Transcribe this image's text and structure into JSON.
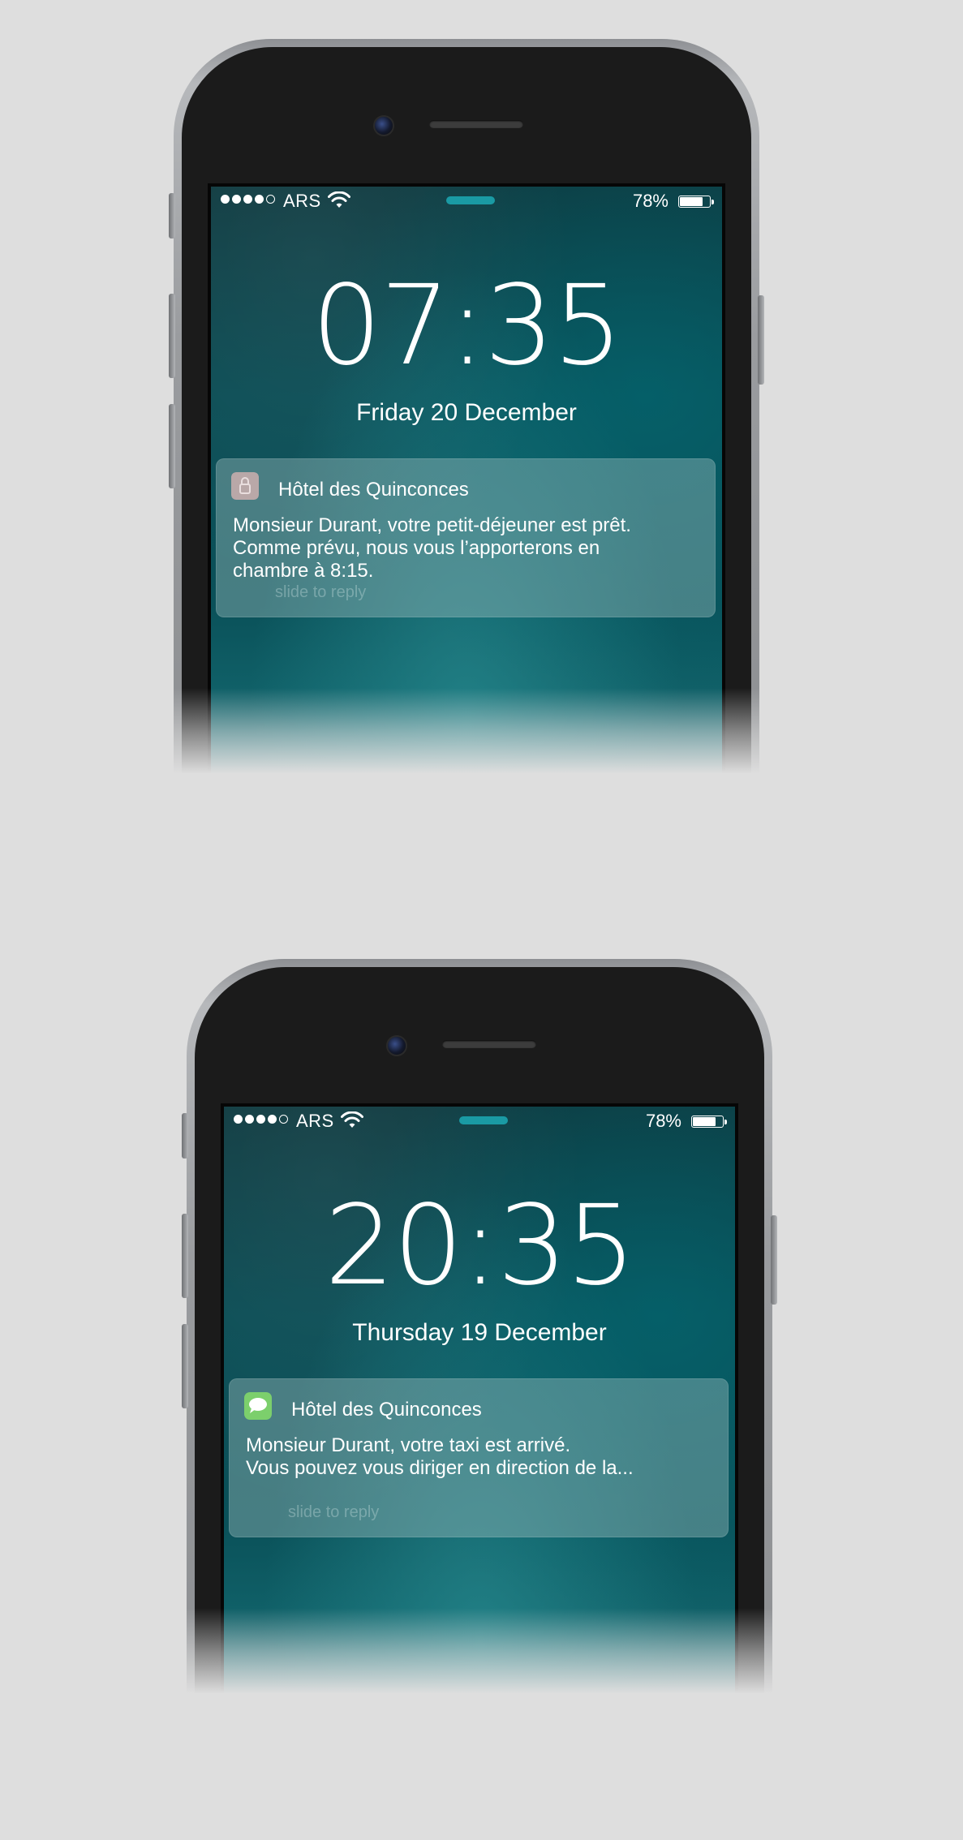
{
  "phones": [
    {
      "status": {
        "carrier": "ARS",
        "battery": "78%",
        "battery_level": 0.78,
        "signal_bars": 4,
        "signal_max": 5
      },
      "clock": "07:35",
      "date": "Friday 20 December",
      "notification": {
        "app_icon": "lock-icon",
        "app_name": "Hôtel des Quinconces",
        "body": "Monsieur Durant, votre petit-déjeuner est prêt.\nComme prévu, nous vous l’apporterons en chambre à 8:15.",
        "line1": "Monsieur Durant, votre petit-déjeuner est prêt.",
        "line2": "Comme prévu, nous vous l’apporterons en",
        "line3": "chambre à 8:15.",
        "hint": "slide to reply"
      }
    },
    {
      "status": {
        "carrier": "ARS",
        "battery": "78%",
        "battery_level": 0.78,
        "signal_bars": 4,
        "signal_max": 5
      },
      "clock": "20:35",
      "date": "Thursday 19 December",
      "notification": {
        "app_icon": "messages-icon",
        "app_name": "Hôtel des Quinconces",
        "line1": "Monsieur Durant, votre taxi est arrivé.",
        "line2": "Vous pouvez vous diriger en direction de la...",
        "hint": "slide to reply"
      }
    }
  ],
  "colors": {
    "background": "#dedede",
    "lock_handle": "#1a9aa4",
    "messages_green": "#7ccf6c"
  }
}
